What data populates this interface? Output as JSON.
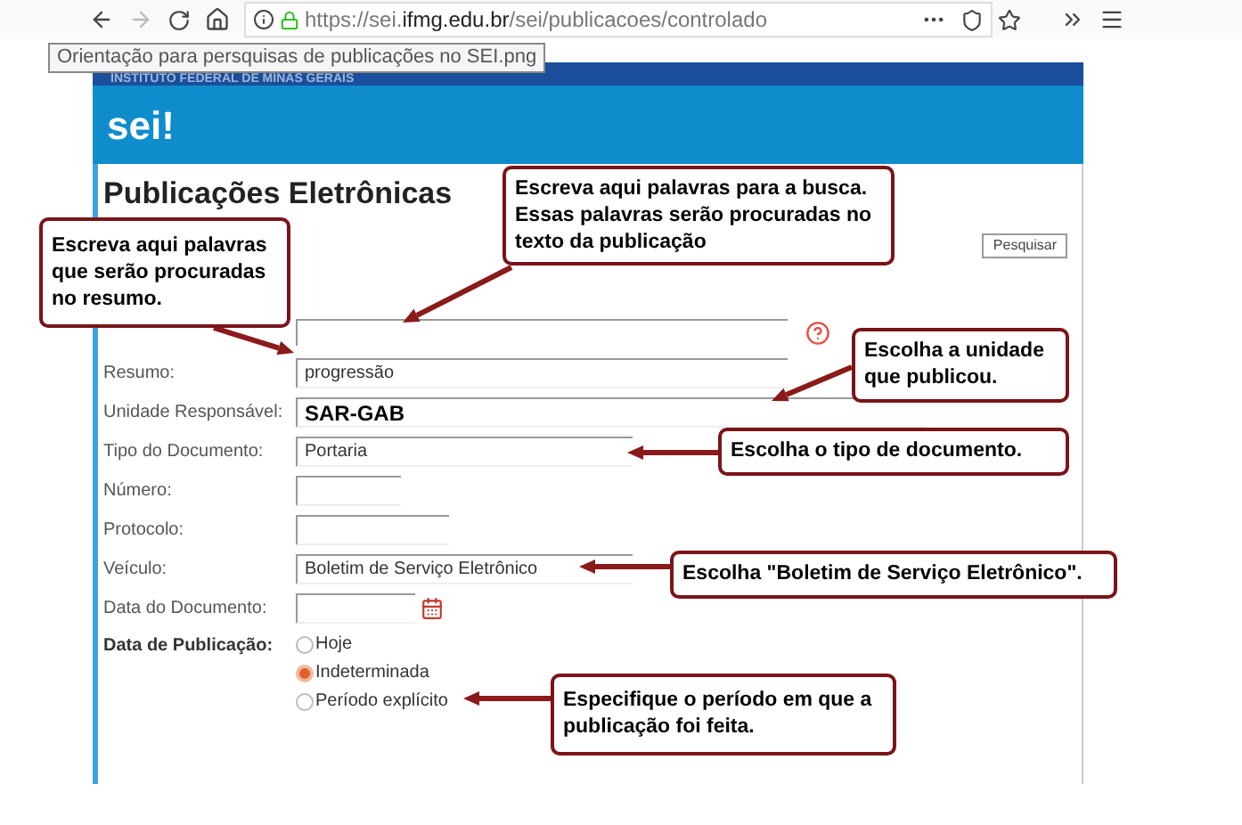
{
  "browser": {
    "url": {
      "prefix": "https://sei.",
      "host": "ifmg.edu.br",
      "path": "/sei/publicacoes/controlado"
    }
  },
  "tooltip": "Orientação para persquisas de publicações no SEI.png",
  "header": {
    "institution": "INSTITUTO FEDERAL DE MINAS GERAIS",
    "logo": "sei!"
  },
  "page_title": "Publicações Eletrônicas",
  "search_button": "Pesquisar",
  "fields": [
    {
      "label": "Resumo:",
      "kind": "text",
      "value": "progressão"
    },
    {
      "label": "Unidade Responsável:",
      "kind": "wide",
      "value": "SAR-GAB"
    },
    {
      "label": "Tipo do Documento:",
      "kind": "select",
      "value": "Portaria"
    },
    {
      "label": "Número:",
      "kind": "short"
    },
    {
      "label": "Protocolo:",
      "kind": "medium"
    },
    {
      "label": "Veículo:",
      "kind": "select",
      "value": "Boletim de Serviço Eletrônico"
    },
    {
      "label": "Data do Documento:",
      "kind": "date"
    }
  ],
  "publication_date": {
    "label": "Data de Publicação:",
    "options": [
      {
        "label": "Hoje",
        "selected": false
      },
      {
        "label": "Indeterminada",
        "selected": true
      },
      {
        "label": "Período explícito",
        "selected": false
      }
    ]
  },
  "callouts": [
    {
      "text": "Escreva aqui palavras para a busca. Essas palavras serão procuradas no texto da publicação"
    },
    {
      "text": "Escreva aqui palavras que serão procuradas no resumo."
    },
    {
      "text": "Escolha a unidade que publicou."
    },
    {
      "text": "Escolha o tipo de documento."
    },
    {
      "text": "Escolha \"Boletim de Serviço Eletrônico\"."
    },
    {
      "text": "Especifique o período em que a publicação foi feita."
    }
  ]
}
